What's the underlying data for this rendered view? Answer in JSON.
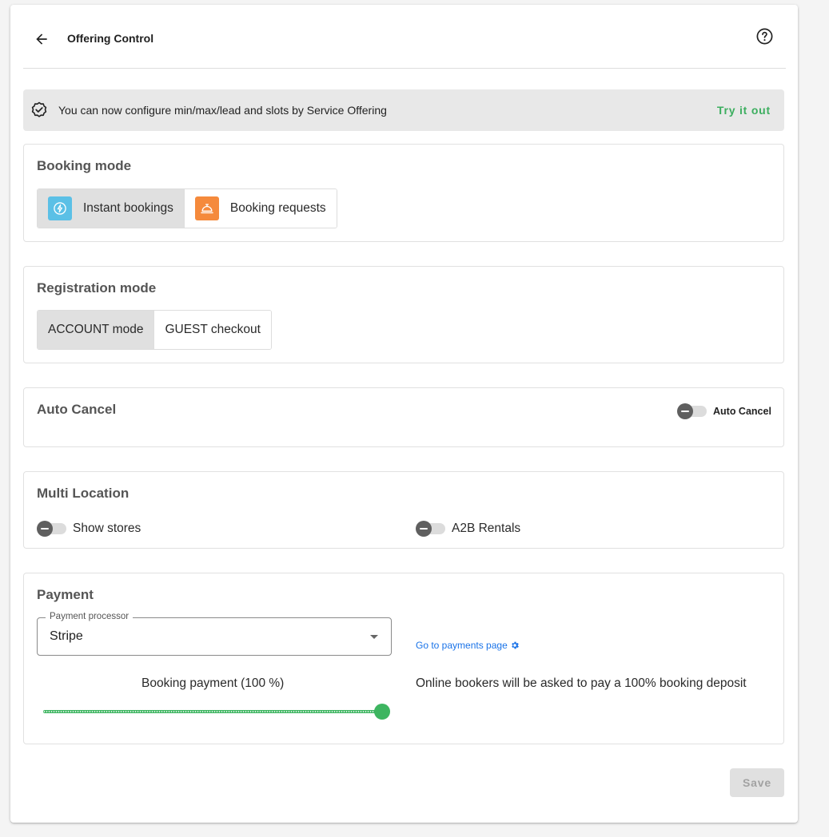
{
  "header": {
    "title": "Offering Control",
    "back_icon": "arrow-left-icon",
    "help_icon": "help-circle-icon"
  },
  "banner": {
    "icon": "verified-badge-icon",
    "text": "You can now configure min/max/lead and slots by Service Offering",
    "action": "Try it out",
    "action_color": "#3cae5f"
  },
  "booking_mode": {
    "title": "Booking mode",
    "options": [
      {
        "label": "Instant bookings",
        "icon": "lightning-icon",
        "icon_color": "#5bc0e6",
        "selected": true
      },
      {
        "label": "Booking requests",
        "icon": "service-bell-icon",
        "icon_color": "#f58a3c",
        "selected": false
      }
    ]
  },
  "registration_mode": {
    "title": "Registration mode",
    "options": [
      {
        "label": "ACCOUNT mode",
        "selected": true
      },
      {
        "label": "GUEST checkout",
        "selected": false
      }
    ]
  },
  "auto_cancel": {
    "title": "Auto Cancel",
    "toggle_label": "Auto Cancel",
    "enabled": false
  },
  "multi_location": {
    "title": "Multi Location",
    "toggles": [
      {
        "label": "Show stores",
        "enabled": false
      },
      {
        "label": "A2B Rentals",
        "enabled": false
      }
    ]
  },
  "payment": {
    "title": "Payment",
    "processor_label": "Payment processor",
    "processor_value": "Stripe",
    "payments_link": "Go to payments page",
    "booking_payment_label": "Booking payment (100 %)",
    "booking_payment_percent": 100,
    "deposit_text": "Online bookers will be asked to pay a 100% booking deposit",
    "slider_color": "#3db560"
  },
  "footer": {
    "save_label": "Save"
  }
}
